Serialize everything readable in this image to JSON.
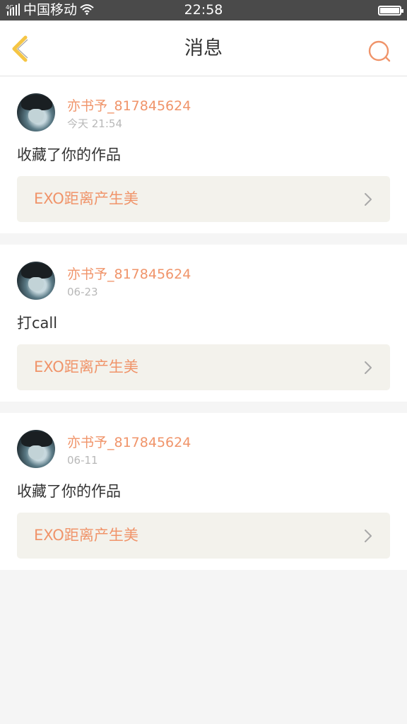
{
  "status_bar": {
    "carrier": "中国移动",
    "time": "22:58"
  },
  "header": {
    "title": "消息"
  },
  "colors": {
    "accent": "#f0946a",
    "back_icon": "#f5c544",
    "link_background": "#f3f2ec",
    "status_bar": "#4a4a4a"
  },
  "icons": {
    "back": "chevron-left-icon",
    "search": "search-icon",
    "link_arrow": "chevron-right-icon"
  },
  "messages": [
    {
      "username": "亦书予_817845624",
      "timestamp": "今天 21:54",
      "action": "收藏了你的作品",
      "work_title": "EXO距离产生美"
    },
    {
      "username": "亦书予_817845624",
      "timestamp": "06-23",
      "action": "打call",
      "work_title": "EXO距离产生美"
    },
    {
      "username": "亦书予_817845624",
      "timestamp": "06-11",
      "action": "收藏了你的作品",
      "work_title": "EXO距离产生美"
    }
  ]
}
